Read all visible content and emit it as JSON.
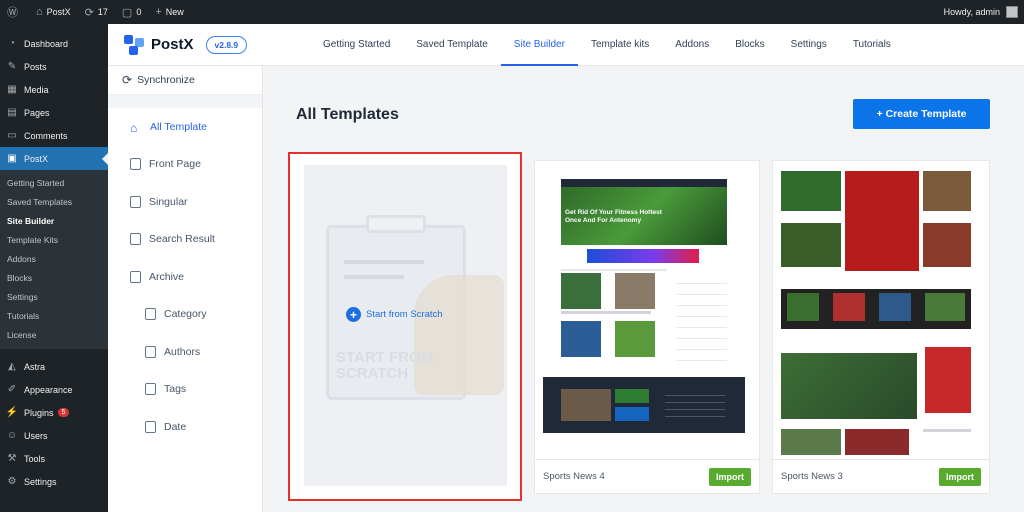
{
  "adminbar": {
    "site": "PostX",
    "updates": "17",
    "comments": "0",
    "new": "New",
    "howdy": "Howdy, admin"
  },
  "wpmenu": {
    "items_top": [
      {
        "label": "Dashboard",
        "icon": "dashboard-icon"
      },
      {
        "label": "Posts",
        "icon": "pin-icon"
      },
      {
        "label": "Media",
        "icon": "media-icon"
      },
      {
        "label": "Pages",
        "icon": "pages-icon"
      },
      {
        "label": "Comments",
        "icon": "comment-icon"
      }
    ],
    "active": {
      "label": "PostX",
      "icon": "postx-icon"
    },
    "submenu": [
      "Getting Started",
      "Saved Templates",
      "Site Builder",
      "Template Kits",
      "Addons",
      "Blocks",
      "Settings",
      "Tutorials",
      "License"
    ],
    "items_bottom": [
      {
        "label": "Astra",
        "icon": "astra-icon"
      },
      {
        "label": "Appearance",
        "icon": "brush-icon"
      },
      {
        "label": "Plugins",
        "icon": "plug-icon",
        "badge": "5"
      },
      {
        "label": "Users",
        "icon": "users-icon"
      },
      {
        "label": "Tools",
        "icon": "wrench-icon"
      },
      {
        "label": "Settings",
        "icon": "settings-icon"
      }
    ]
  },
  "topnav": {
    "logo": "PostX",
    "version": "v2.8.9",
    "tabs": [
      "Getting Started",
      "Saved Template",
      "Site Builder",
      "Template kits",
      "Addons",
      "Blocks",
      "Settings",
      "Tutorials"
    ],
    "active_tab": "Site Builder"
  },
  "sidebar": {
    "sync": "Synchronize",
    "items": [
      "All Template",
      "Front Page",
      "Singular",
      "Search Result",
      "Archive"
    ],
    "sub_items": [
      "Category",
      "Authors",
      "Tags",
      "Date"
    ]
  },
  "main": {
    "title": "All Templates",
    "create": "+ Create Template",
    "scratch": "Start from Scratch",
    "cards": [
      {
        "name": "Sports News 4",
        "import": "Import"
      },
      {
        "name": "Sports News 3",
        "import": "Import"
      }
    ]
  },
  "colors": {
    "accent": "#0a74e8",
    "wp_active": "#2271b1",
    "import_green": "#58ab2e",
    "highlight_red": "#e5312d"
  }
}
